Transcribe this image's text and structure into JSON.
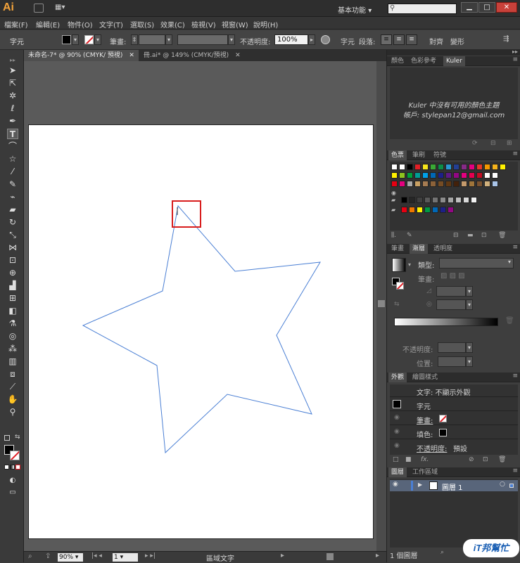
{
  "app": {
    "logo": "Ai",
    "workspace": "基本功能"
  },
  "menu": [
    "檔案(F)",
    "編輯(E)",
    "物件(O)",
    "文字(T)",
    "選取(S)",
    "效果(C)",
    "檢視(V)",
    "視窗(W)",
    "說明(H)"
  ],
  "control": {
    "type_label": "字元",
    "stroke_label": "筆畫:",
    "opacity_label": "不透明度:",
    "opacity_value": "100%",
    "char_link": "字元",
    "para_link": "段落:",
    "align_link": "對齊",
    "transform_link": "變形"
  },
  "tabs": [
    {
      "label": "未命名-7* @ 90% (CMYK/ 預視)",
      "active": true
    },
    {
      "label": "冊.ai* @ 149% (CMYK/預視)",
      "active": false
    }
  ],
  "status": {
    "zoom": "90%",
    "page": "1",
    "mode": "區域文字"
  },
  "kuler": {
    "tabs": [
      "顏色",
      "色彩參考",
      "Kuler"
    ],
    "message": "Kuler 中沒有可用的顏色主題",
    "account": "帳戶: stylepan12@gmail.com"
  },
  "swatches": {
    "tabs": [
      "色票",
      "筆刷",
      "符號"
    ],
    "row1": [
      "#ffffff",
      "#ffffff",
      "#000000",
      "#e11f26",
      "#f6e61b",
      "#3aa935",
      "#0c8d47",
      "#2b98d3",
      "#233f93",
      "#862b87",
      "#e4007f",
      "#e83828",
      "#f29800",
      "#f5b31c",
      "#fff100"
    ],
    "row2": [
      "#fff100",
      "#8fc31f",
      "#00a13a",
      "#009e96",
      "#00a0e9",
      "#0068b7",
      "#1d2088",
      "#601986",
      "#920783",
      "#e4007f",
      "#e5004f",
      "#c30d23",
      "#ffffff",
      "#ffffff"
    ],
    "row3": [
      "#e60012",
      "#e4007f",
      "#a8a8a8",
      "#c8a063",
      "#a67c52",
      "#8c6239",
      "#754c24",
      "#603813",
      "#42210b",
      "#c49a6c",
      "#a0753a",
      "#7a5230",
      "#d0b07c",
      "#a9c4e8"
    ],
    "gray": [
      "#000000",
      "#262626",
      "#404040",
      "#595959",
      "#737373",
      "#8c8c8c",
      "#a6a6a6",
      "#bfbfbf",
      "#d9d9d9",
      "#f2f2f2"
    ],
    "bright": [
      "#e60012",
      "#ee7700",
      "#fff100",
      "#009944",
      "#0068b7",
      "#1d2088",
      "#920783"
    ]
  },
  "gradient": {
    "tabs": [
      "筆畫",
      "漸層",
      "透明度"
    ],
    "type_label": "類型:",
    "stroke_label": "筆畫:",
    "opacity_label": "不透明度:",
    "position_label": "位置:"
  },
  "appearance": {
    "tabs": [
      "外觀",
      "繪圖樣式"
    ],
    "header": "文字: 不顯示外觀",
    "char_label": "字元",
    "stroke_label": "筆畫:",
    "fill_label": "填色:",
    "opacity_label": "不透明度:",
    "opacity_value": "預設",
    "fx": "fx."
  },
  "layers": {
    "tabs": [
      "圖層",
      "工作區域"
    ],
    "layer_name": "圖層 1",
    "footer": "1 個圖層"
  },
  "watermark": "iT邦幫忙"
}
